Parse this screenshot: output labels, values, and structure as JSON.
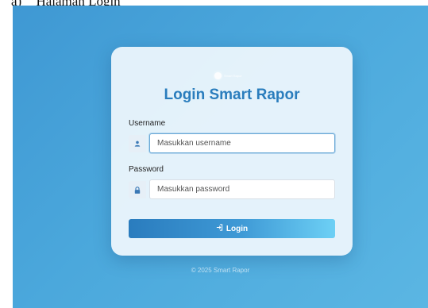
{
  "document": {
    "caption_number": "a)",
    "caption_text": "Halaman Login"
  },
  "login": {
    "logo_text": "Smart Rapor",
    "title": "Login Smart Rapor",
    "username_label": "Username",
    "username_placeholder": "Masukkan username",
    "password_label": "Password",
    "password_placeholder": "Masukkan password",
    "button_label": "Login"
  },
  "footer": {
    "copyright": "© 2025 Smart Rapor"
  },
  "icons": {
    "username": "user-icon",
    "password": "lock-icon",
    "button": "sign-in-icon"
  },
  "colors": {
    "background": "#4ba8dc",
    "title": "#2a7dbd",
    "button_start": "#2a7cbe",
    "button_end": "#6dd0f5"
  }
}
